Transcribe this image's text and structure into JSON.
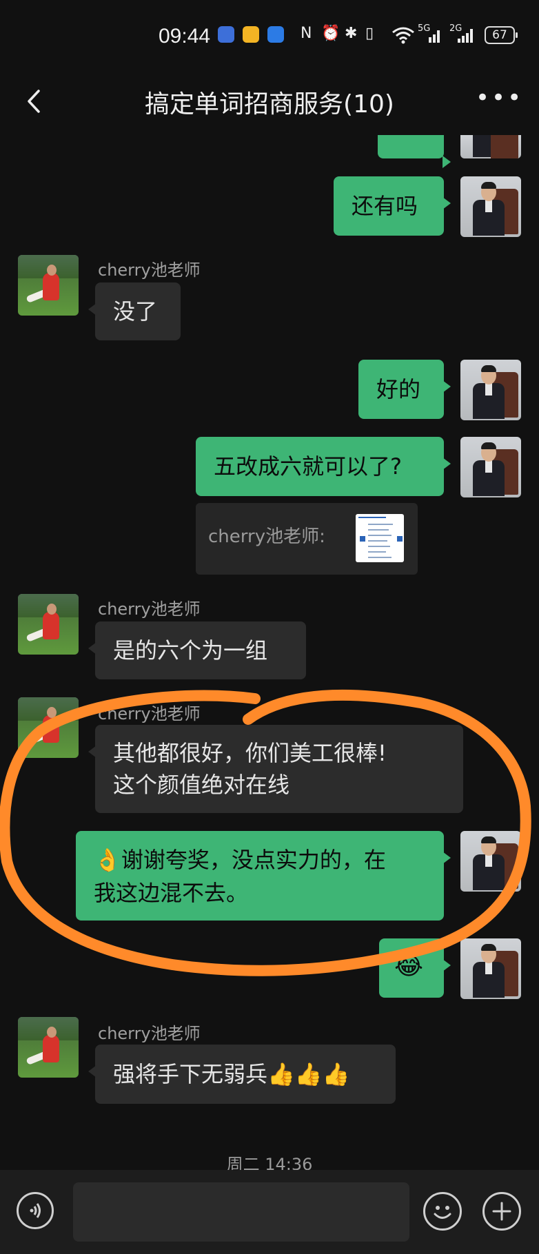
{
  "status_bar": {
    "time": "09:44",
    "indicators": [
      "N",
      "⏰",
      "✱",
      "▯",
      "5G",
      "2G"
    ],
    "battery": "67"
  },
  "header": {
    "title": "搞定单词招商服务(10)",
    "back_icon": "chevron-left-icon",
    "more_icon": "more-dots-icon",
    "more_label": "•••"
  },
  "messages": {
    "m1": "还有吗",
    "m2_sender": "cherry池老师",
    "m2": "没了",
    "m3": "好的",
    "m4": "五改成六就可以了?",
    "m4_quote": "cherry池老师:",
    "m5_sender": "cherry池老师",
    "m5": "是的六个为一组",
    "m6_sender": "cherry池老师",
    "m6_line1": "其他都很好，你们美工很棒!",
    "m6_line2": "这个颜值绝对在线",
    "m7_line1": "👌谢谢夸奖，没点实力的，在",
    "m7_line2": "我这边混不去。",
    "m8": "😂",
    "m9_sender": "cherry池老师",
    "m9": "强将手下无弱兵👍👍👍"
  },
  "timestamp": "周二 14:36",
  "composer": {
    "voice_icon": "voice-icon",
    "emoji_icon": "emoji-icon",
    "plus_icon": "plus-icon",
    "input_value": ""
  },
  "colors": {
    "background": "#111111",
    "outgoing_bubble": "#3eb575",
    "incoming_bubble": "#2c2c2c",
    "annotation": "#ff8a2a"
  }
}
